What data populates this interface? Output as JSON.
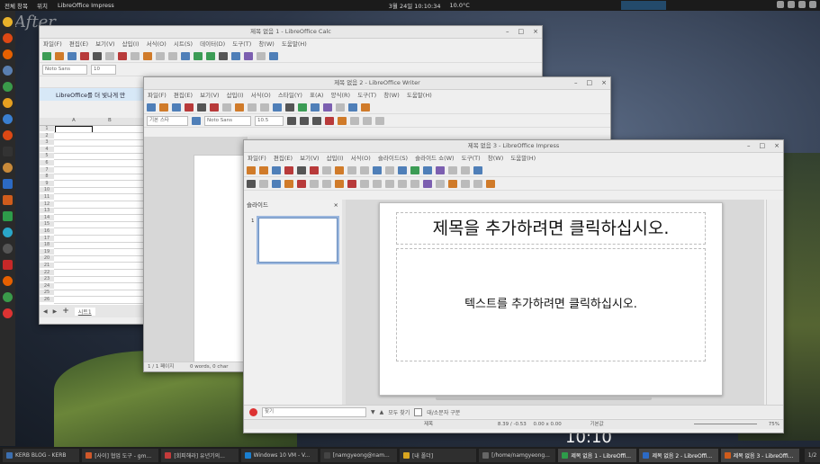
{
  "wallpaper": {
    "watermark": "After",
    "clock": "10:10"
  },
  "top_panel": {
    "left_items": [
      "전체 창목",
      "위치"
    ],
    "active_window": "LibreOffice Impress",
    "datetime": "3월 24일 10:10:34",
    "extra": "10.0°C"
  },
  "dock": {
    "icons": [
      "chat-icon",
      "ubuntu-icon",
      "firefox-icon",
      "files-icon",
      "chrome-icon",
      "app-icon",
      "email-icon",
      "ubuntu-icon",
      "terminal-icon",
      "folder-icon",
      "writer-icon",
      "impress-icon",
      "calc-icon",
      "settings-icon",
      "draw-icon",
      "sticky-icon",
      "firefox-icon",
      "software-icon",
      "chat-icon"
    ]
  },
  "taskbar": {
    "items": [
      {
        "label": "KERB BLOG - KERB",
        "color": "#3c6fb0"
      },
      {
        "label": "[사이] 협업 도구 - gm...",
        "color": "#d0582a"
      },
      {
        "label": "[회피해라] 유년기의...",
        "color": "#c43b3b"
      },
      {
        "label": "Windows 10 VM - V...",
        "color": "#1a7fd0"
      },
      {
        "label": "[namgyeong@nam...",
        "color": "#444444"
      },
      {
        "label": "[내 폴더]",
        "color": "#d9a520"
      },
      {
        "label": "[/home/namgyeong...",
        "color": "#666666"
      },
      {
        "label": "제목 없음 1 - LibreOffi...",
        "color": "#2e9c4a"
      },
      {
        "label": "제목 없음 2 - LibreOffi...",
        "color": "#2c6ac4"
      },
      {
        "label": "제목 없음 3 - LibreOffi...",
        "color": "#d05c1c"
      }
    ],
    "pager": "1/2"
  },
  "calc": {
    "title": "제목 없음 1 - LibreOffice Calc",
    "menu": [
      "파일(F)",
      "편집(E)",
      "보기(V)",
      "삽입(I)",
      "서식(O)",
      "시트(S)",
      "데이터(D)",
      "도구(T)",
      "창(W)",
      "도움말(H)"
    ],
    "font_name": "Noto Sans",
    "font_size": "10",
    "infobar": "LibreOffice를 더 빛나게 만",
    "col_a": "A",
    "col_b": "B",
    "rows": [
      "1",
      "2",
      "3",
      "4",
      "5",
      "6",
      "7",
      "8",
      "9",
      "10",
      "11",
      "12",
      "13",
      "14",
      "15",
      "16",
      "17",
      "18",
      "19",
      "20",
      "21",
      "22",
      "23",
      "24",
      "25",
      "26"
    ],
    "sheet_tab": "시트1"
  },
  "writer": {
    "title": "제목 없음 2 - LibreOffice Writer",
    "menu": [
      "파일(F)",
      "편집(E)",
      "보기(V)",
      "삽입(I)",
      "서식(O)",
      "스타일(Y)",
      "표(A)",
      "양식(R)",
      "도구(T)",
      "창(W)",
      "도움말(H)"
    ],
    "para_style": "기본 스타",
    "font_name": "Noto Sans",
    "font_size": "10.5",
    "status_page": "1 / 1 페이지",
    "status_words": "0 words, 0 char"
  },
  "impress": {
    "title": "제목 없음 3 - LibreOffice Impress",
    "menu": [
      "파일(F)",
      "편집(E)",
      "보기(V)",
      "삽입(I)",
      "서식(O)",
      "슬라이드(S)",
      "슬라이드 쇼(W)",
      "도구(T)",
      "창(W)",
      "도움말(H)"
    ],
    "panel_title": "슬라이드",
    "panel_close": "×",
    "slide_number": "1",
    "title_placeholder": "제목을 추가하려면 클릭하십시오.",
    "content_placeholder": "텍스트를 추가하려면 클릭하십시오.",
    "find_placeholder": "찾기",
    "find_all": "모두 찾기",
    "match_case": "대/소문자 구분",
    "status_layout": "제목",
    "status_pos": "8.39 / -0.53",
    "status_size": "0.00 x 0.00",
    "status_master": "기본값",
    "zoom": "75%"
  },
  "colors": {
    "calc": "#2e9c4a",
    "writer": "#2c6ac4",
    "impress": "#d05c1c",
    "infobar": "#d7e8f7"
  }
}
